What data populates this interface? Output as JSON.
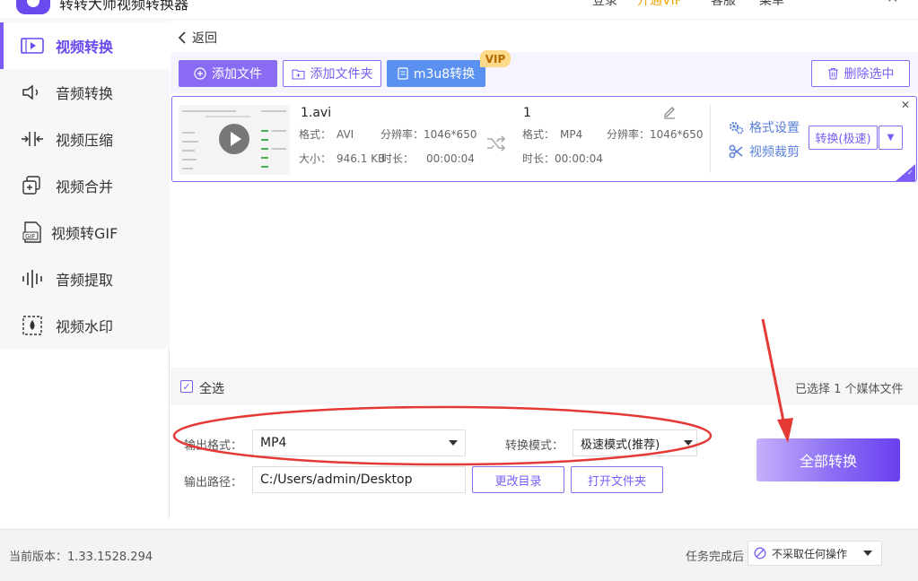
{
  "titlebar": {
    "title": "转转大师视频转换器",
    "items": [
      "登录",
      "开通VIP",
      "客服",
      "菜单"
    ],
    "minimize": "—",
    "close": "✕"
  },
  "sidebar": {
    "items": [
      {
        "label": "视频转换",
        "icon": "video-convert-icon",
        "active": true
      },
      {
        "label": "音频转换",
        "icon": "audio-convert-icon"
      },
      {
        "label": "视频压缩",
        "icon": "compress-icon"
      },
      {
        "label": "视频合并",
        "icon": "merge-icon"
      },
      {
        "label": "视频转GIF",
        "icon": "gif-icon"
      },
      {
        "label": "音频提取",
        "icon": "waveform-icon"
      },
      {
        "label": "视频水印",
        "icon": "watermark-icon"
      }
    ]
  },
  "nav": {
    "back_label": "返回"
  },
  "toolbar": {
    "add_file": "添加文件",
    "add_folder": "添加文件夹",
    "m3u8": "m3u8转换",
    "vip": "VIP",
    "delete_selected": "删除选中"
  },
  "file": {
    "source": {
      "name": "1.avi",
      "format_label": "格式：",
      "format": "AVI",
      "resolution_label": "分辨率：",
      "resolution": "1046*650",
      "size_label": "大小：",
      "size": "946.1 KB",
      "duration_label": "时长：",
      "duration": "00:00:04"
    },
    "target": {
      "name": "1",
      "format_label": "格式：",
      "format": "MP4",
      "resolution_label": "分辨率：",
      "resolution": "1046*650",
      "duration_label": "时长：",
      "duration": "00:00:04"
    },
    "format_settings": "格式设置",
    "video_crop": "视频裁剪",
    "convert_button": "转换(极速)"
  },
  "selection": {
    "select_all": "全选",
    "count_text": "已选择 1 个媒体文件"
  },
  "output": {
    "format_label": "输出格式：",
    "format_value": "MP4",
    "mode_label": "转换模式：",
    "mode_value": "极速模式(推荐)",
    "path_label": "输出路径：",
    "path_value": "C:/Users/admin/Desktop",
    "change_dir": "更改目录",
    "open_folder": "打开文件夹",
    "convert_all": "全部转换"
  },
  "status": {
    "version": "当前版本：1.33.1528.294",
    "after_label": "任务完成后",
    "after_value": "不采取任何操作"
  },
  "colors": {
    "accent": "#7b5cf5",
    "m3u8": "#5a90f0",
    "annotation": "#e53935"
  }
}
